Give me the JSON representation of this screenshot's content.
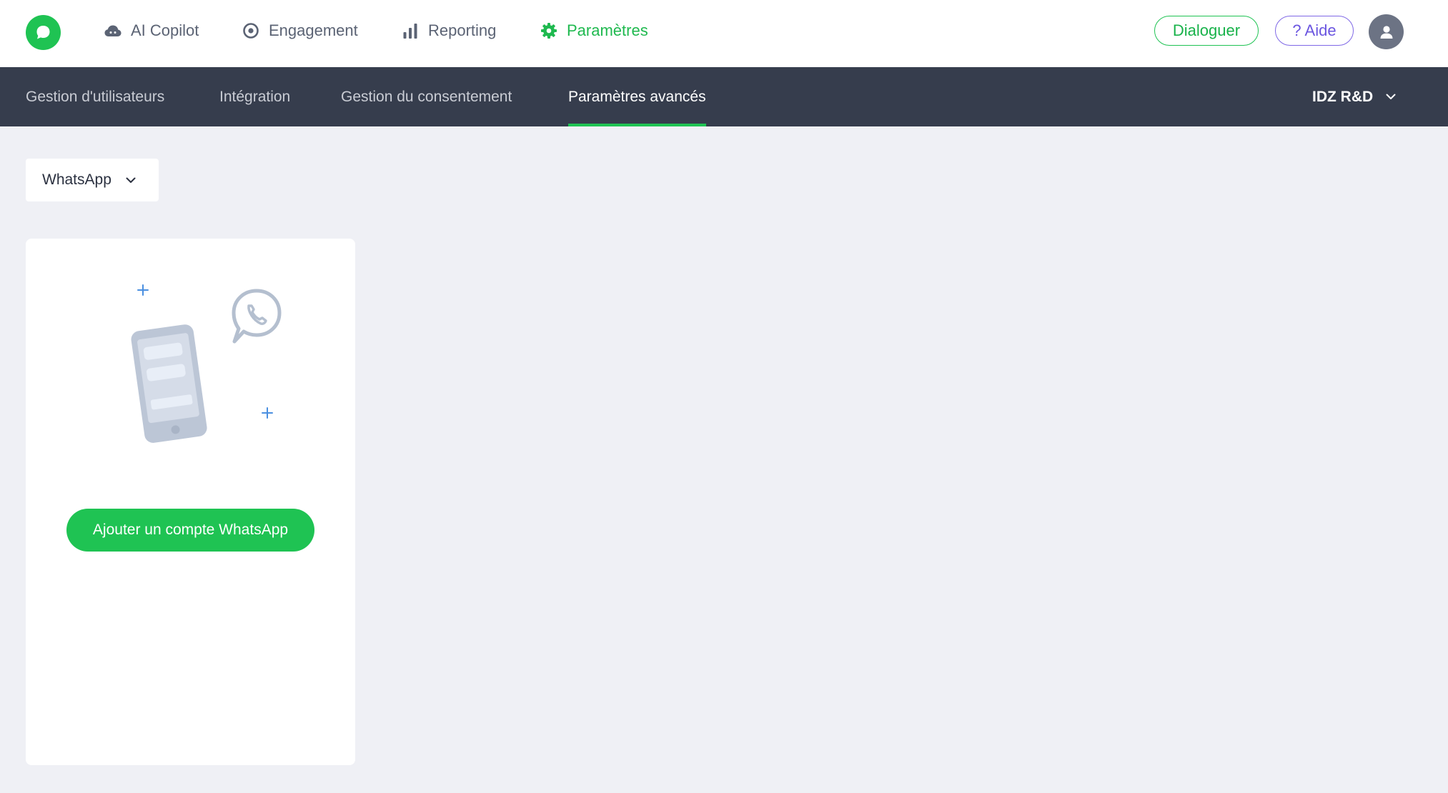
{
  "topnav": {
    "items": [
      {
        "label": "AI Copilot",
        "icon": "cloud-icon"
      },
      {
        "label": "Engagement",
        "icon": "target-icon"
      },
      {
        "label": "Reporting",
        "icon": "bar-chart-icon"
      },
      {
        "label": "Paramètres",
        "icon": "gear-icon",
        "active": true
      }
    ],
    "dialoguer_label": "Dialoguer",
    "aide_label": "? Aide"
  },
  "subnav": {
    "items": [
      {
        "label": "Gestion d'utilisateurs"
      },
      {
        "label": "Intégration"
      },
      {
        "label": "Gestion du consentement"
      },
      {
        "label": "Paramètres avancés",
        "active": true
      }
    ],
    "org_label": "IDZ R&D"
  },
  "channel_select": {
    "value": "WhatsApp"
  },
  "card": {
    "cta_label": "Ajouter un compte WhatsApp"
  },
  "colors": {
    "brand_green": "#1fc353",
    "subnav_bg": "#363d4d",
    "aide_purple": "#7f68e6",
    "page_bg": "#eff0f5"
  }
}
